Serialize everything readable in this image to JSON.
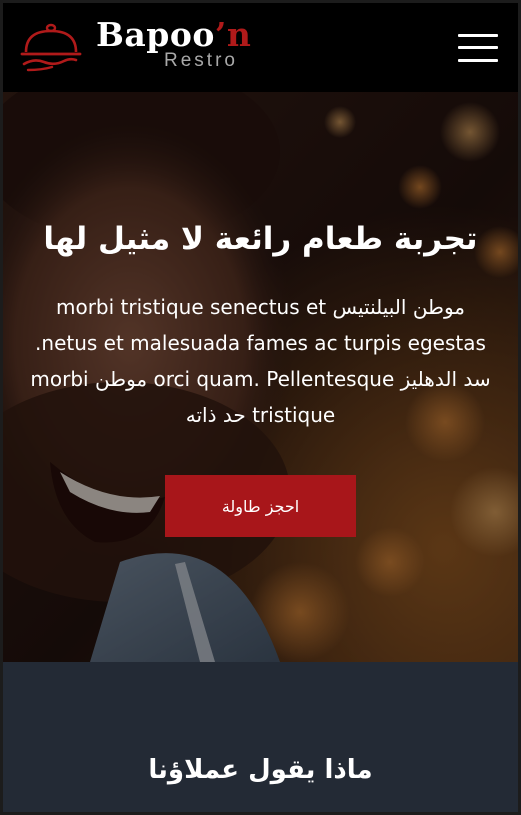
{
  "header": {
    "brand_main": "Bapoo",
    "brand_accent": "’n",
    "brand_sub": "Restro",
    "logo_icon": "cloche-icon",
    "menu_icon": "hamburger-icon"
  },
  "hero": {
    "title": "تجربة طعام رائعة لا مثيل لها",
    "text": "موطن البيلنتيس morbi tristique senectus et netus et malesuada fames ac turpis egestas. سد الدهليز orci quam. Pellentesque موطن morbi tristique حد ذاته",
    "cta_label": "احجز طاولة"
  },
  "testimonials": {
    "title": "ماذا يقول عملاؤنا"
  },
  "colors": {
    "accent": "#a8161a",
    "header_bg": "#000000",
    "section_bg": "#232a35"
  }
}
